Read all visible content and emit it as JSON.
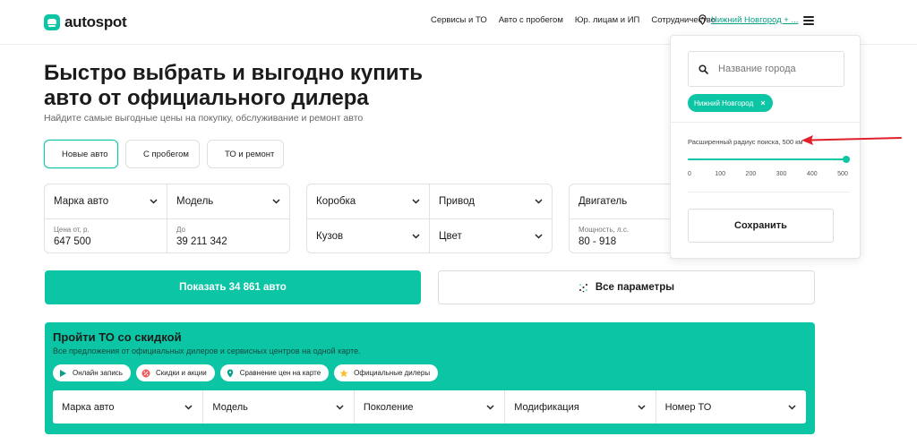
{
  "header": {
    "logo": "autospot",
    "nav": [
      "Сервисы и ТО",
      "Авто с пробегом",
      "Юр. лицам и ИП",
      "Сотрудничество"
    ],
    "city": "Нижний Новгород + ..."
  },
  "hero": {
    "title": "Быстро выбрать и выгодно купить авто от официального дилера",
    "subtitle": "Найдите самые выгодные цены на покупку, обслуживание и ремонт авто"
  },
  "tabs": [
    {
      "label": "Новые авто",
      "active": true,
      "icon": "car-icon"
    },
    {
      "label": "С пробегом",
      "active": false,
      "icon": "car-icon"
    },
    {
      "label": "ТО и ремонт",
      "active": false,
      "icon": "wrench-icon"
    }
  ],
  "filters": {
    "brand": "Марка авто",
    "model": "Модель",
    "price_from_label": "Цена от, р.",
    "price_from": "647 500",
    "price_to_label": "До",
    "price_to": "39 211 342",
    "gearbox": "Коробка",
    "drive": "Привод",
    "body": "Кузов",
    "color": "Цвет",
    "engine": "Двигатель",
    "power_label": "Мощность, л.с.",
    "power": "80 - 918"
  },
  "buttons": {
    "show": "Показать 34 861 авто",
    "all_params": "Все параметры"
  },
  "promo": {
    "title": "Пройти ТО со скидкой",
    "subtitle": "Все предложения от официальных дилеров и сервисных центров на одной карте.",
    "chips": [
      {
        "label": "Онлайн запись",
        "icon": "play-icon"
      },
      {
        "label": "Скидки и акции",
        "icon": "percent-icon"
      },
      {
        "label": "Сравнение цен на карте",
        "icon": "map-pin-icon"
      },
      {
        "label": "Официальные дилеры",
        "icon": "star-icon"
      }
    ],
    "selects": [
      "Марка авто",
      "Модель",
      "Поколение",
      "Модификация",
      "Номер ТО"
    ]
  },
  "city_panel": {
    "search_placeholder": "Название города",
    "selected_city": "Нижний Новгород",
    "radius_label": "Расширенный радиус поиска, 500 км",
    "radius_value_km": 500,
    "radius_max_km": 500,
    "ticks": [
      "0",
      "100",
      "200",
      "300",
      "400",
      "500"
    ],
    "save": "Сохранить"
  },
  "colors": {
    "accent": "#0cc5a4",
    "annotation_arrow": "#e0202a"
  }
}
